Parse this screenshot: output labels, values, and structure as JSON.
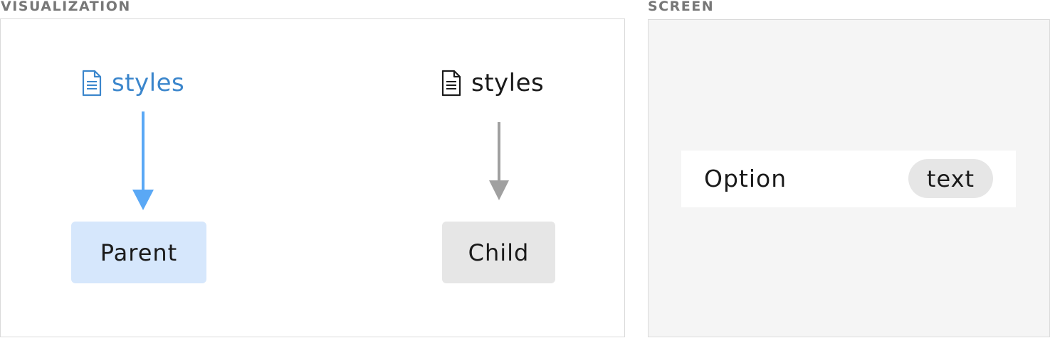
{
  "visualization": {
    "label": "VISUALIZATION",
    "parent_styles_label": "styles",
    "child_styles_label": "styles",
    "parent_label": "Parent",
    "child_label": "Child"
  },
  "screen": {
    "label": "SCREEN",
    "option_label": "Option",
    "badge_text": "text"
  },
  "colors": {
    "parent_accent": "#3b86cc",
    "parent_arrow": "#5aa8f5",
    "parent_node_bg": "#d6e7fc",
    "child_arrow": "#a0a0a0",
    "child_node_bg": "#e6e6e6",
    "screen_bg": "#f5f5f5"
  },
  "icons": {
    "parent_styles_icon": "document-icon",
    "child_styles_icon": "document-icon"
  }
}
